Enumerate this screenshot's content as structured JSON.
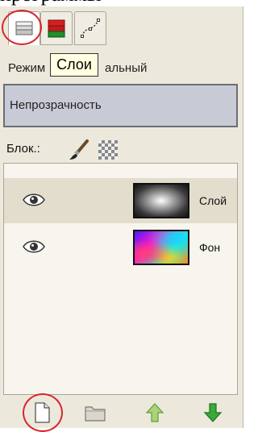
{
  "window": {
    "title_fragment": "программы"
  },
  "tabs": [
    {
      "name": "layers",
      "icon": "layers-icon",
      "active": true
    },
    {
      "name": "channels",
      "icon": "channels-icon",
      "active": false
    },
    {
      "name": "paths",
      "icon": "paths-icon",
      "active": false
    }
  ],
  "tooltip": {
    "text": "Слои"
  },
  "mode": {
    "label": "Режим",
    "value": "альный"
  },
  "opacity": {
    "label": "Непрозрачность"
  },
  "lock": {
    "label": "Блок.:",
    "icons": [
      "brush-lock-icon",
      "alpha-lock-icon"
    ]
  },
  "layers": [
    {
      "name": "Слой",
      "visible": true,
      "selected": true
    },
    {
      "name": "Фон",
      "visible": true,
      "selected": false
    }
  ],
  "bottom_buttons": [
    "new-layer-icon",
    "new-group-icon",
    "raise-layer-icon",
    "lower-layer-icon"
  ],
  "colors": {
    "annotation_circle": "#d9252b",
    "panel_bg": "#ece9dc",
    "opacity_bg": "#c8cbd6",
    "tooltip_bg": "#ffffe1",
    "raise_arrow": "#7bbf3a",
    "lower_arrow": "#3aa83a"
  }
}
